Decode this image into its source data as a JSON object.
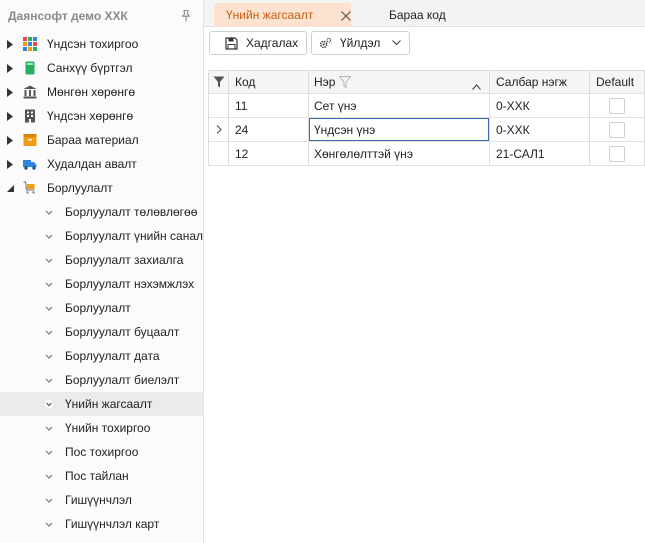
{
  "sidebar": {
    "title": "Даянсофт демо ХХК",
    "pin_icon": "pin-icon",
    "top_items": [
      {
        "label": "Үндсэн тохиргоо",
        "icon": "grid-icon",
        "expanded": false
      },
      {
        "label": "Санхүү бүртгэл",
        "icon": "book-icon",
        "expanded": false
      },
      {
        "label": "Мөнгөн хөрөнгө",
        "icon": "bank-icon",
        "expanded": false
      },
      {
        "label": "Үндсэн хөрөнгө",
        "icon": "building-icon",
        "expanded": false
      },
      {
        "label": "Бараа материал",
        "icon": "box-icon",
        "expanded": false
      },
      {
        "label": "Худалдан авалт",
        "icon": "truck-icon",
        "expanded": false
      },
      {
        "label": "Борлуулалт",
        "icon": "cart-icon",
        "expanded": true
      }
    ],
    "children": [
      {
        "label": "Борлуулалт төлөвлөгөө"
      },
      {
        "label": "Борлуулалт үнийн санал"
      },
      {
        "label": "Борлуулалт захиалга"
      },
      {
        "label": "Борлуулалт нэхэмжлэх"
      },
      {
        "label": "Борлуулалт"
      },
      {
        "label": "Борлуулалт буцаалт"
      },
      {
        "label": "Борлуулалт дата"
      },
      {
        "label": "Борлуулалт биелэлт"
      },
      {
        "label": "Үнийн жагсаалт",
        "selected": true
      },
      {
        "label": "Үнийн тохиргоо"
      },
      {
        "label": "Пос тохиргоо"
      },
      {
        "label": "Пос тайлан"
      },
      {
        "label": "Гишүүнчлэл"
      },
      {
        "label": "Гишүүнчлэл карт"
      }
    ]
  },
  "tabs": [
    {
      "label": "Үнийн жагсаалт",
      "active": true
    },
    {
      "label": "Бараа код",
      "active": false
    }
  ],
  "toolbar": {
    "save_label": "Хадгалах",
    "action_label": "Үйлдэл"
  },
  "grid": {
    "columns": [
      "Код",
      "Нэр",
      "Салбар нэгж",
      "Default"
    ],
    "rows": [
      {
        "code": "11",
        "name": "Сет үнэ",
        "branch": "0-ХХК",
        "default": false,
        "current": false
      },
      {
        "code": "24",
        "name": "Үндсэн үнэ",
        "branch": "0-ХХК",
        "default": false,
        "current": true
      },
      {
        "code": "12",
        "name": "Хөнгөлөлттэй үнэ",
        "branch": "21-САЛ1",
        "default": false,
        "current": false
      }
    ]
  },
  "colors": {
    "accent": "#c75d16",
    "tab_active_bg": "#fde3cf",
    "edit_border": "#3d6bb4"
  }
}
